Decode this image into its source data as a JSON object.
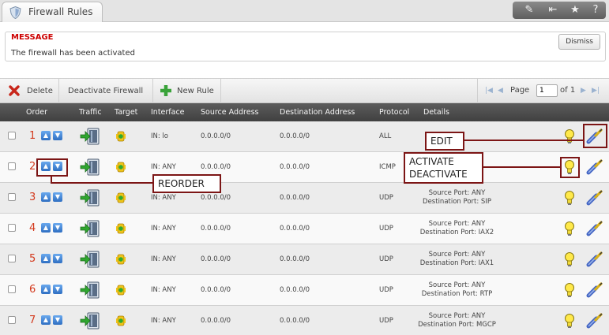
{
  "window": {
    "tab_title": "Firewall Rules",
    "buttons": [
      {
        "name": "edit-window-icon",
        "glyph": "✎"
      },
      {
        "name": "collapse-icon",
        "glyph": "⇤"
      },
      {
        "name": "star-icon",
        "glyph": "★"
      },
      {
        "name": "help-icon",
        "glyph": "?"
      }
    ]
  },
  "message": {
    "label": "MESSAGE",
    "text": "The firewall has been activated",
    "dismiss_label": "Dismiss"
  },
  "toolbar": {
    "delete_label": "Delete",
    "deactivate_label": "Deactivate Firewall",
    "new_rule_label": "New Rule",
    "pager": {
      "page_label": "Page",
      "page_value": "1",
      "of_label": "of 1"
    }
  },
  "table": {
    "headers": {
      "order": "Order",
      "traffic": "Traffic",
      "target": "Target",
      "interface": "Interface",
      "source": "Source Address",
      "destination": "Destination Address",
      "protocol": "Protocol",
      "details": "Details"
    },
    "rows": [
      {
        "order": "1",
        "interface": "IN: lo",
        "source": "0.0.0.0/0",
        "destination": "0.0.0.0/0",
        "protocol": "ALL",
        "details_1": "",
        "details_2": ""
      },
      {
        "order": "2",
        "interface": "IN: ANY",
        "source": "0.0.0.0/0",
        "destination": "0.0.0.0/0",
        "protocol": "ICMP",
        "details_1": "",
        "details_2": ""
      },
      {
        "order": "3",
        "interface": "IN: ANY",
        "source": "0.0.0.0/0",
        "destination": "0.0.0.0/0",
        "protocol": "UDP",
        "details_1": "Source Port: ANY",
        "details_2": "Destination Port: SIP"
      },
      {
        "order": "4",
        "interface": "IN: ANY",
        "source": "0.0.0.0/0",
        "destination": "0.0.0.0/0",
        "protocol": "UDP",
        "details_1": "Source Port: ANY",
        "details_2": "Destination Port: IAX2"
      },
      {
        "order": "5",
        "interface": "IN: ANY",
        "source": "0.0.0.0/0",
        "destination": "0.0.0.0/0",
        "protocol": "UDP",
        "details_1": "Source Port: ANY",
        "details_2": "Destination Port: IAX1"
      },
      {
        "order": "6",
        "interface": "IN: ANY",
        "source": "0.0.0.0/0",
        "destination": "0.0.0.0/0",
        "protocol": "UDP",
        "details_1": "Source Port: ANY",
        "details_2": "Destination Port: RTP"
      },
      {
        "order": "7",
        "interface": "IN: ANY",
        "source": "0.0.0.0/0",
        "destination": "0.0.0.0/0",
        "protocol": "UDP",
        "details_1": "Source Port: ANY",
        "details_2": "Destination Port: MGCP"
      }
    ]
  },
  "annotations": {
    "edit": "EDIT",
    "activate_1": "ACTIVATE",
    "activate_2": "DEACTIVATE",
    "reorder": "REORDER"
  },
  "colors": {
    "accent_red": "#cc0000",
    "order_number": "#d33a1e",
    "annotation": "#7c1515",
    "header_bg": "#4a4a4a"
  }
}
